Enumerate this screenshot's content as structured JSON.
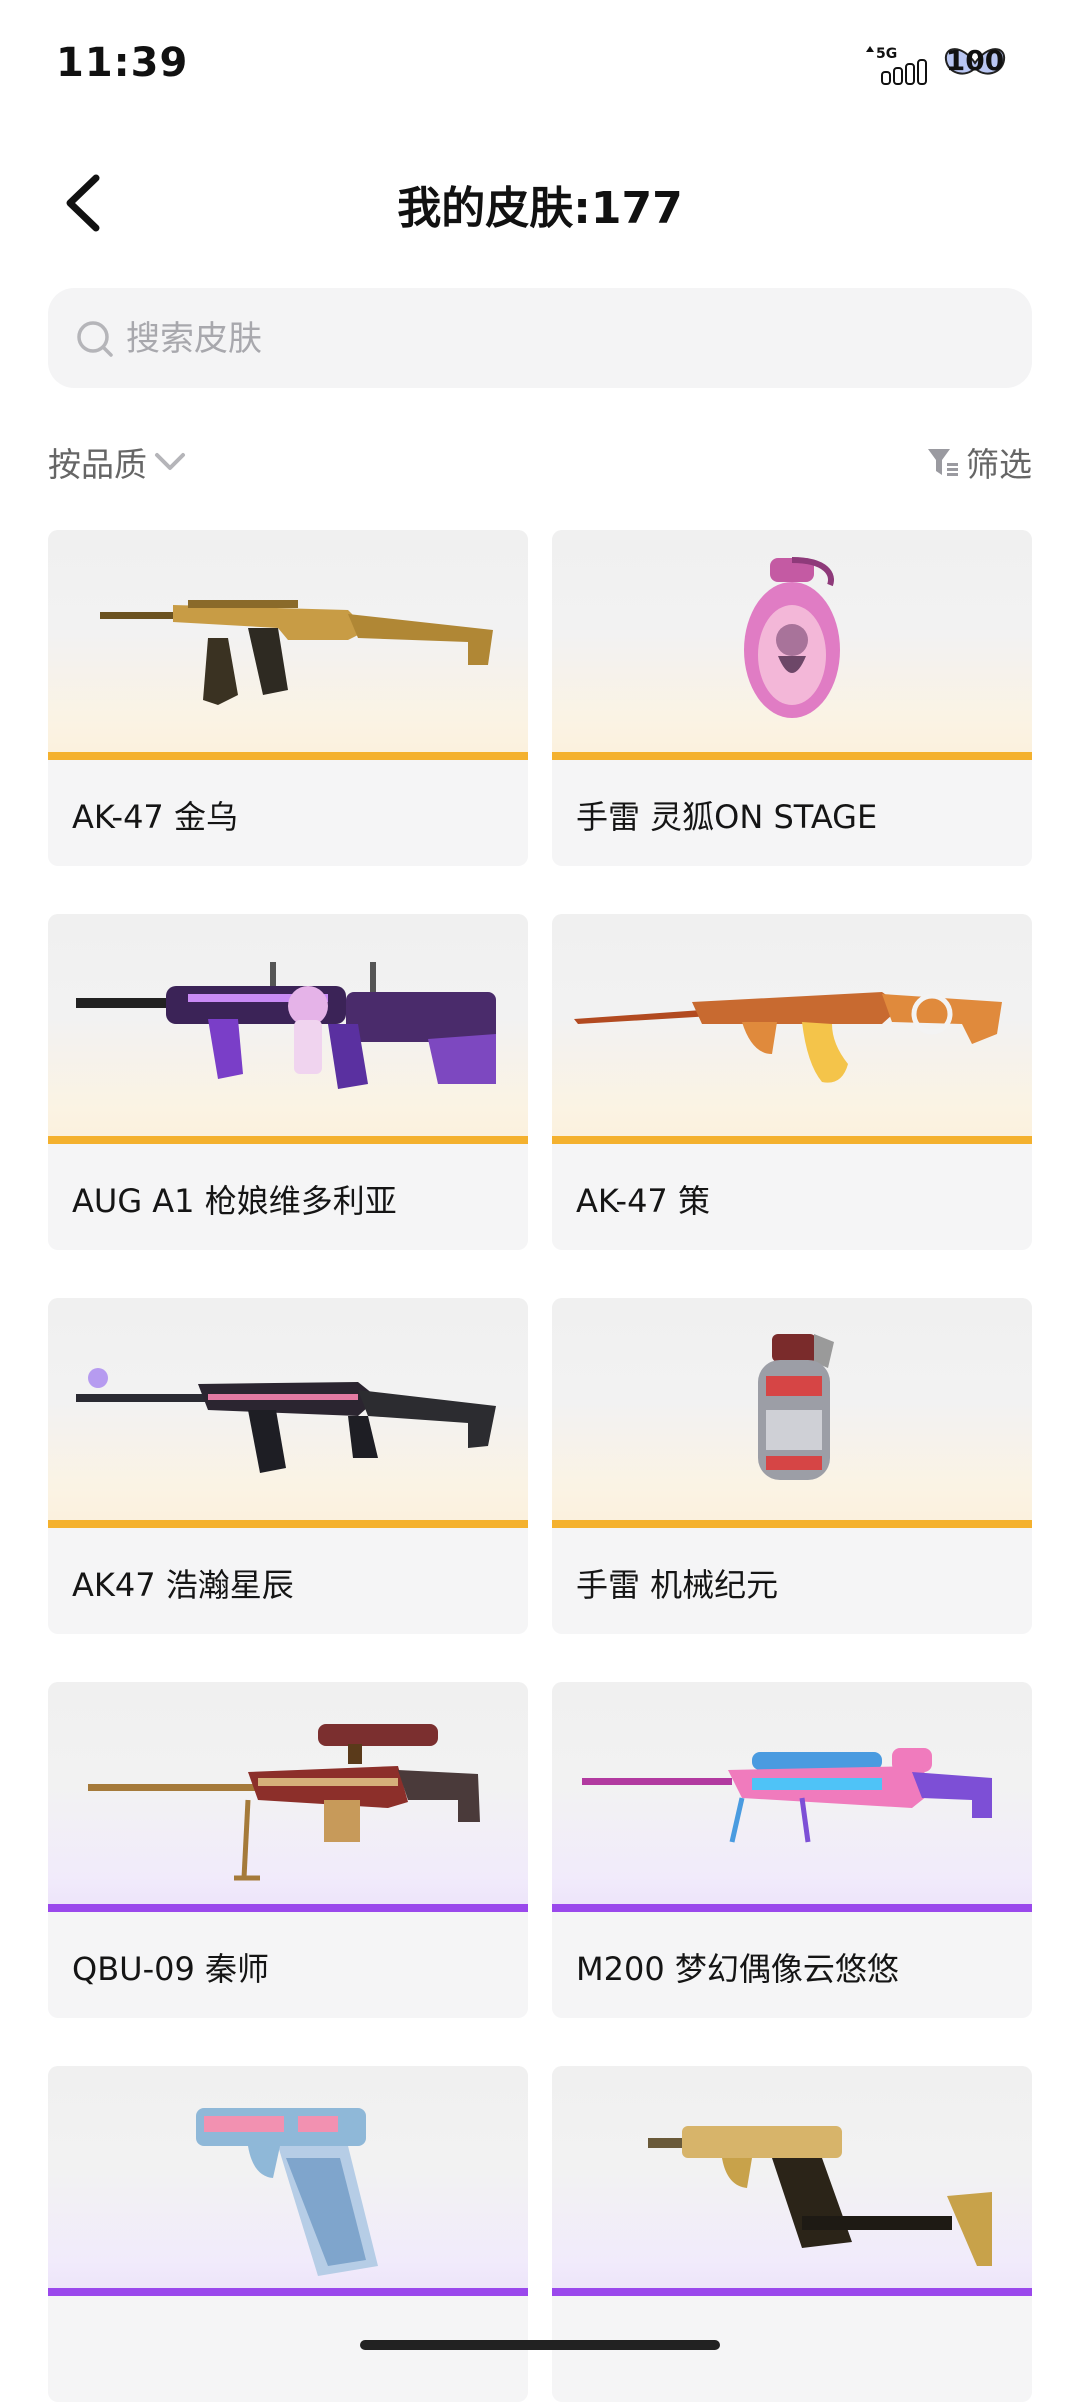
{
  "status": {
    "time": "11:39",
    "network": "5G",
    "battery": "100"
  },
  "header": {
    "title": "我的皮肤:177"
  },
  "search": {
    "placeholder": "搜索皮肤",
    "value": ""
  },
  "toolbar": {
    "sort_label": "按品质",
    "filter_label": "筛选"
  },
  "colors": {
    "gold_rarity": "#f4b12e",
    "purple_rarity": "#9a48ec",
    "card_bg": "#f5f5f6"
  },
  "skins": [
    {
      "name": "AK-47 金乌",
      "rarity": "gold",
      "icon": "rifle-icon"
    },
    {
      "name": "手雷 灵狐ON STAGE",
      "rarity": "gold",
      "icon": "grenade-icon"
    },
    {
      "name": "AUG A1 枪娘维多利亚",
      "rarity": "gold",
      "icon": "rifle-icon"
    },
    {
      "name": "AK-47 策",
      "rarity": "gold",
      "icon": "rifle-icon"
    },
    {
      "name": "AK47 浩瀚星辰",
      "rarity": "gold",
      "icon": "rifle-icon"
    },
    {
      "name": "手雷 机械纪元",
      "rarity": "gold",
      "icon": "grenade-icon"
    },
    {
      "name": "QBU-09 秦师",
      "rarity": "purple",
      "icon": "sniper-icon"
    },
    {
      "name": "M200 梦幻偶像云悠悠",
      "rarity": "purple",
      "icon": "sniper-icon"
    },
    {
      "name": "",
      "rarity": "purple",
      "icon": "pistol-icon"
    },
    {
      "name": "",
      "rarity": "purple",
      "icon": "pistol-icon"
    }
  ]
}
